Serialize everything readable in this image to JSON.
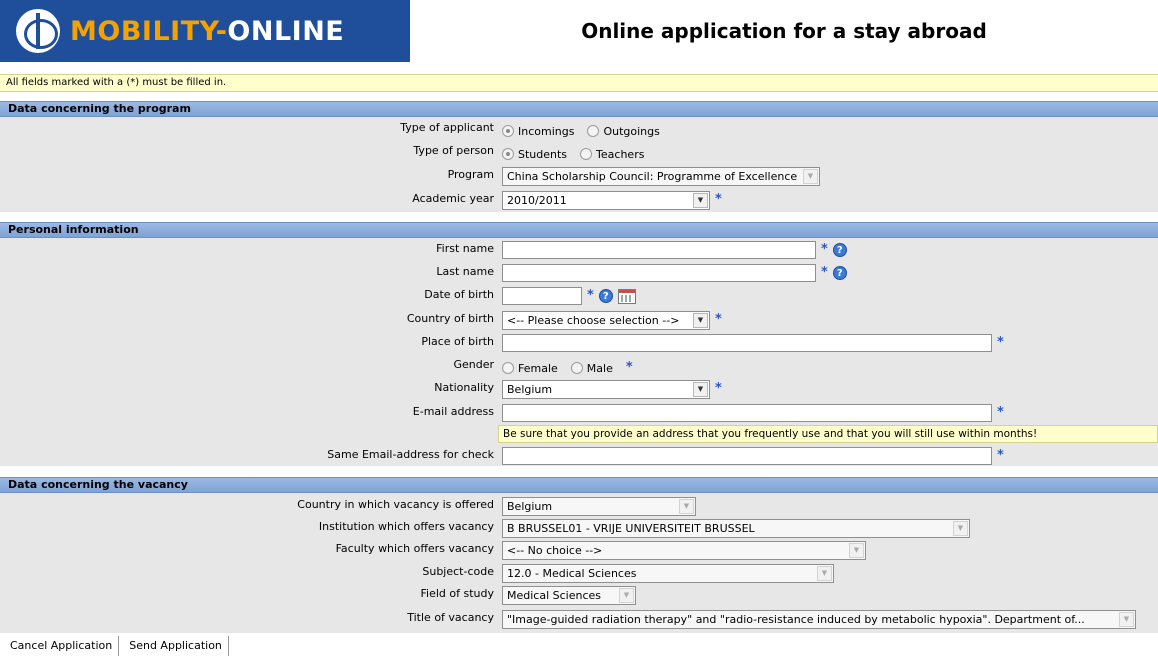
{
  "header": {
    "logo_part1": "MOBILITY-",
    "logo_part2": "ONLINE",
    "title": "Online application for a stay abroad"
  },
  "required_note": "All fields marked with a (*) must be filled in.",
  "required_mark": "*",
  "program_section": {
    "heading": "Data concerning the program",
    "type_of_applicant": {
      "label": "Type of applicant",
      "options": [
        "Incomings",
        "Outgoings"
      ],
      "selected": "Incomings"
    },
    "type_of_person": {
      "label": "Type of person",
      "options": [
        "Students",
        "Teachers"
      ],
      "selected": "Students"
    },
    "program": {
      "label": "Program",
      "value": "China Scholarship Council: Programme of Excellence"
    },
    "academic_year": {
      "label": "Academic year",
      "value": "2010/2011"
    }
  },
  "personal_section": {
    "heading": "Personal information",
    "first_name": {
      "label": "First name",
      "value": ""
    },
    "last_name": {
      "label": "Last name",
      "value": ""
    },
    "date_of_birth": {
      "label": "Date of birth",
      "value": ""
    },
    "country_of_birth": {
      "label": "Country of birth",
      "value": "<-- Please choose selection -->"
    },
    "place_of_birth": {
      "label": "Place of birth",
      "value": ""
    },
    "gender": {
      "label": "Gender",
      "options": [
        "Female",
        "Male"
      ]
    },
    "nationality": {
      "label": "Nationality",
      "value": "Belgium"
    },
    "email": {
      "label": "E-mail address",
      "value": ""
    },
    "email_hint": "Be sure that you provide an address that you frequently use and that you will still use within months!",
    "email_check": {
      "label": "Same Email-address for check",
      "value": ""
    }
  },
  "vacancy_section": {
    "heading": "Data concerning the vacancy",
    "country": {
      "label": "Country in which vacancy is offered",
      "value": "Belgium"
    },
    "institution": {
      "label": "Institution which offers vacancy",
      "value": "B BRUSSEL01 - VRIJE UNIVERSITEIT BRUSSEL"
    },
    "faculty": {
      "label": "Faculty which offers vacancy",
      "value": "<-- No choice -->"
    },
    "subject_code": {
      "label": "Subject-code",
      "value": "12.0 - Medical Sciences"
    },
    "field_of_study": {
      "label": "Field of study",
      "value": "Medical Sciences"
    },
    "title_of_vacancy": {
      "label": "Title of vacancy",
      "value": "\"Image-guided radiation therapy\" and \"radio-resistance induced by metabolic hypoxia\". Department of..."
    }
  },
  "buttons": {
    "cancel": "Cancel Application",
    "send": "Send Application"
  },
  "icons": {
    "help": "?",
    "dropdown_arrow": "▼"
  },
  "colors": {
    "logo_background": "#1f4e9a",
    "logo_accent": "#f5a200",
    "section_header": "#8fb0de",
    "form_background": "#e7e7e7",
    "note_background": "#ffffcc",
    "required_star": "#2a56c6"
  }
}
